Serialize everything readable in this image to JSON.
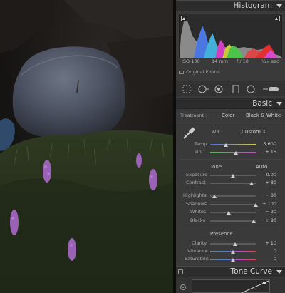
{
  "panel": {
    "histogram_title": "Histogram",
    "basic_title": "Basic",
    "tone_curve_title": "Tone Curve"
  },
  "exif": {
    "iso": "ISO 100",
    "focal": "14 mm",
    "aperture": "f / 10",
    "shutter": "¹⁄₁₀₀ sec"
  },
  "original_photo_label": "Original Photo",
  "treatment": {
    "label": "Treatment :",
    "color": "Color",
    "bw": "Black & White"
  },
  "wb": {
    "label": "WB :",
    "value": "Custom ↕"
  },
  "tone_header": {
    "label": "Tone",
    "auto": "Auto"
  },
  "presence_header": {
    "label": "Presence"
  },
  "sliders": {
    "temp": {
      "label": "Temp",
      "value": "5,600",
      "level": 0.35
    },
    "tint": {
      "label": "Tint",
      "value": "+ 15",
      "level": 0.57
    },
    "exposure": {
      "label": "Exposure",
      "value": "0.00",
      "level": 0.5
    },
    "contrast": {
      "label": "Contrast",
      "value": "+ 80",
      "level": 0.9
    },
    "highlights": {
      "label": "Highlights",
      "value": "− 80",
      "level": 0.1
    },
    "shadows": {
      "label": "Shadows",
      "value": "+ 100",
      "level": 1.0
    },
    "whites": {
      "label": "Whites",
      "value": "− 20",
      "level": 0.4
    },
    "blacks": {
      "label": "Blacks",
      "value": "+ 90",
      "level": 0.95
    },
    "clarity": {
      "label": "Clarity",
      "value": "+ 10",
      "level": 0.55
    },
    "vibrance": {
      "label": "Vibrance",
      "value": "0",
      "level": 0.5
    },
    "saturation": {
      "label": "Saturation",
      "value": "0",
      "level": 0.5
    }
  },
  "colors": {
    "panel_bg": "#3a3a3a",
    "header_bg": "#2c2c2c",
    "temp_track_left": "#4a6cd4",
    "temp_track_right": "#d8c84a",
    "tint_track_left": "#4cbf4c",
    "tint_track_right": "#c04cc0"
  }
}
